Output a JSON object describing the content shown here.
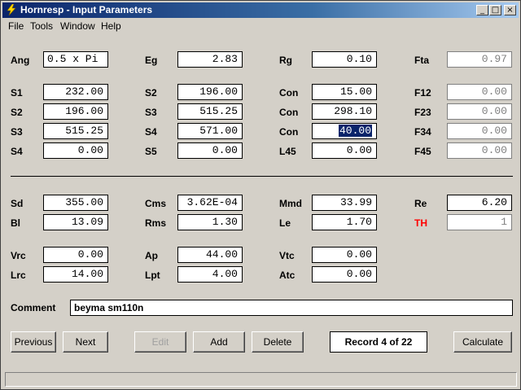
{
  "window": {
    "title": "Hornresp - Input Parameters",
    "minimize": "_",
    "maximize": "□",
    "close": "×"
  },
  "menu": [
    "File",
    "Tools",
    "Window",
    "Help"
  ],
  "fields": {
    "ang": {
      "label": "Ang",
      "value": "0.5 x Pi"
    },
    "eg": {
      "label": "Eg",
      "value": "2.83"
    },
    "rg": {
      "label": "Rg",
      "value": "0.10"
    },
    "fta": {
      "label": "Fta",
      "value": "0.97"
    },
    "s1": {
      "label": "S1",
      "value": "232.00"
    },
    "s2b": {
      "label": "S2",
      "value": "196.00"
    },
    "con1": {
      "label": "Con",
      "value": "15.00"
    },
    "f12": {
      "label": "F12",
      "value": "0.00"
    },
    "s2": {
      "label": "S2",
      "value": "196.00"
    },
    "s3b": {
      "label": "S3",
      "value": "515.25"
    },
    "con2": {
      "label": "Con",
      "value": "298.10"
    },
    "f23": {
      "label": "F23",
      "value": "0.00"
    },
    "s3": {
      "label": "S3",
      "value": "515.25"
    },
    "s4b": {
      "label": "S4",
      "value": "571.00"
    },
    "con3": {
      "label": "Con",
      "value": "40.00"
    },
    "f34": {
      "label": "F34",
      "value": "0.00"
    },
    "s4": {
      "label": "S4",
      "value": "0.00"
    },
    "s5": {
      "label": "S5",
      "value": "0.00"
    },
    "l45": {
      "label": "L45",
      "value": "0.00"
    },
    "f45": {
      "label": "F45",
      "value": "0.00"
    },
    "sd": {
      "label": "Sd",
      "value": "355.00"
    },
    "cms": {
      "label": "Cms",
      "value": "3.62E-04"
    },
    "mmd": {
      "label": "Mmd",
      "value": "33.99"
    },
    "re": {
      "label": "Re",
      "value": "6.20"
    },
    "bl": {
      "label": "Bl",
      "value": "13.09"
    },
    "rms": {
      "label": "Rms",
      "value": "1.30"
    },
    "le": {
      "label": "Le",
      "value": "1.70"
    },
    "th": {
      "label": "TH",
      "value": "1"
    },
    "vrc": {
      "label": "Vrc",
      "value": "0.00"
    },
    "ap": {
      "label": "Ap",
      "value": "44.00"
    },
    "vtc": {
      "label": "Vtc",
      "value": "0.00"
    },
    "lrc": {
      "label": "Lrc",
      "value": "14.00"
    },
    "lpt": {
      "label": "Lpt",
      "value": "4.00"
    },
    "atc": {
      "label": "Atc",
      "value": "0.00"
    }
  },
  "comment": {
    "label": "Comment",
    "value": "beyma sm110n"
  },
  "buttons": {
    "previous": "Previous",
    "next": "Next",
    "edit": "Edit",
    "add": "Add",
    "delete": "Delete",
    "calculate": "Calculate"
  },
  "record": "Record 4 of 22",
  "colors": {
    "titlebar": "#0a246a",
    "selection": "#0a246a",
    "th_label": "#ff0000",
    "face": "#d4d0c8"
  }
}
